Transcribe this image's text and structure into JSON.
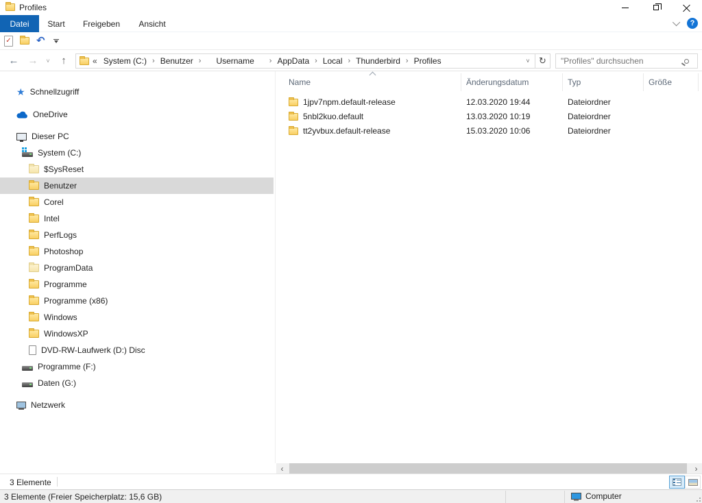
{
  "window": {
    "title": "Profiles"
  },
  "ribbon": {
    "tabs": [
      "Datei",
      "Start",
      "Freigeben",
      "Ansicht"
    ],
    "active_tab": "Datei",
    "help_label": "?"
  },
  "icons": {
    "back": "←",
    "forward": "→",
    "history_chevron": "˅",
    "up": "↑",
    "address_chevron": "˅",
    "refresh": "↻",
    "breadcrumb_prefix": "«",
    "breadcrumb_separator": "›",
    "scroll_left": "‹",
    "scroll_right": "›",
    "quick_access_star": "★",
    "undo": "↶"
  },
  "navbar": {
    "breadcrumb": [
      "System (C:)",
      "Benutzer",
      "Username",
      "AppData",
      "Local",
      "Thunderbird",
      "Profiles"
    ],
    "search_placeholder": "\"Profiles\" durchsuchen"
  },
  "sidebar": {
    "items": [
      {
        "label": "Schnellzugriff",
        "icon": "quick-access-star-icon"
      },
      {
        "label": "OneDrive",
        "icon": "onedrive-cloud-icon"
      },
      {
        "label": "Dieser PC",
        "icon": "this-pc-icon"
      },
      {
        "label": "System (C:)",
        "icon": "system-drive-icon"
      },
      {
        "label": "$SysReset",
        "icon": "folder-icon"
      },
      {
        "label": "Benutzer",
        "icon": "folder-icon",
        "selected": true
      },
      {
        "label": "Corel",
        "icon": "folder-icon"
      },
      {
        "label": "Intel",
        "icon": "folder-icon"
      },
      {
        "label": "PerfLogs",
        "icon": "folder-icon"
      },
      {
        "label": "Photoshop",
        "icon": "folder-icon"
      },
      {
        "label": "ProgramData",
        "icon": "folder-icon"
      },
      {
        "label": "Programme",
        "icon": "folder-icon"
      },
      {
        "label": "Programme (x86)",
        "icon": "folder-icon"
      },
      {
        "label": "Windows",
        "icon": "folder-icon"
      },
      {
        "label": "WindowsXP",
        "icon": "folder-icon"
      },
      {
        "label": "DVD-RW-Laufwerk (D:) Disc",
        "icon": "dvd-drive-icon"
      },
      {
        "label": "Programme (F:)",
        "icon": "drive-icon"
      },
      {
        "label": "Daten (G:)",
        "icon": "drive-icon"
      },
      {
        "label": "Netzwerk",
        "icon": "network-icon"
      }
    ]
  },
  "filelist": {
    "columns": [
      "Name",
      "Änderungsdatum",
      "Typ",
      "Größe"
    ],
    "rows": [
      {
        "name": "1jpv7npm.default-release",
        "date": "12.03.2020 19:44",
        "type": "Dateiordner",
        "size": ""
      },
      {
        "name": "5nbl2kuo.default",
        "date": "13.03.2020 10:19",
        "type": "Dateiordner",
        "size": ""
      },
      {
        "name": "tt2yvbux.default-release",
        "date": "15.03.2020 10:06",
        "type": "Dateiordner",
        "size": ""
      }
    ]
  },
  "statusbar": {
    "count": "3 Elemente"
  },
  "bottombar": {
    "info": "3 Elemente (Freier Speicherplatz: 15,6 GB)",
    "computer_label": "Computer"
  },
  "colors": {
    "active_tab_blue": "#1164b4",
    "selection_gray": "#d9d9d9",
    "folder_yellow": "#f9cf63",
    "help_blue": "#1374d6",
    "view_button_selected_bg": "#d6ebfa",
    "view_button_selected_border": "#5aa2d6"
  }
}
